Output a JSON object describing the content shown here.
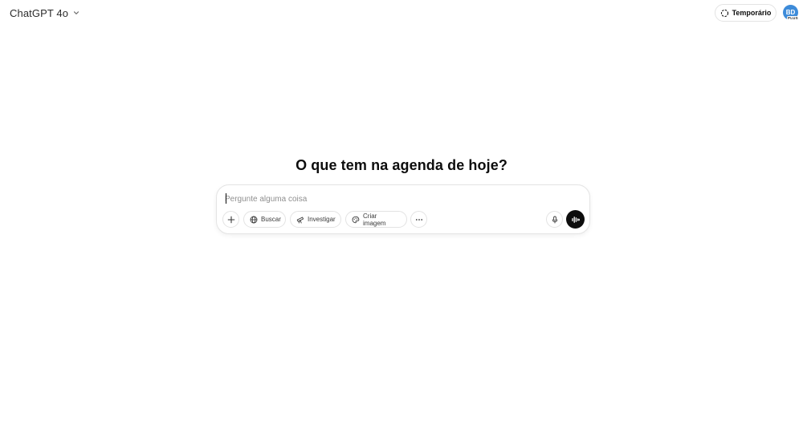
{
  "header": {
    "model_label": "ChatGPT 4o",
    "model_icon": "chevron-down-icon",
    "temporary_label": "Temporário",
    "temporary_icon": "dashed-circle-icon",
    "avatar_initials": "BD",
    "avatar_badge": "PLUS",
    "avatar_color": "#3d8bd9"
  },
  "main": {
    "headline": "O que tem na agenda de hoje?"
  },
  "composer": {
    "placeholder": "Pergunte alguma coisa",
    "tools": {
      "add_icon": "plus-icon",
      "search_label": "Buscar",
      "search_icon": "globe-icon",
      "research_label": "Investigar",
      "research_icon": "telescope-icon",
      "image_label": "Criar imagem",
      "image_icon": "palette-icon",
      "more_icon": "ellipsis-icon"
    },
    "mic_icon": "microphone-icon",
    "voice_icon": "voice-mode-icon"
  }
}
